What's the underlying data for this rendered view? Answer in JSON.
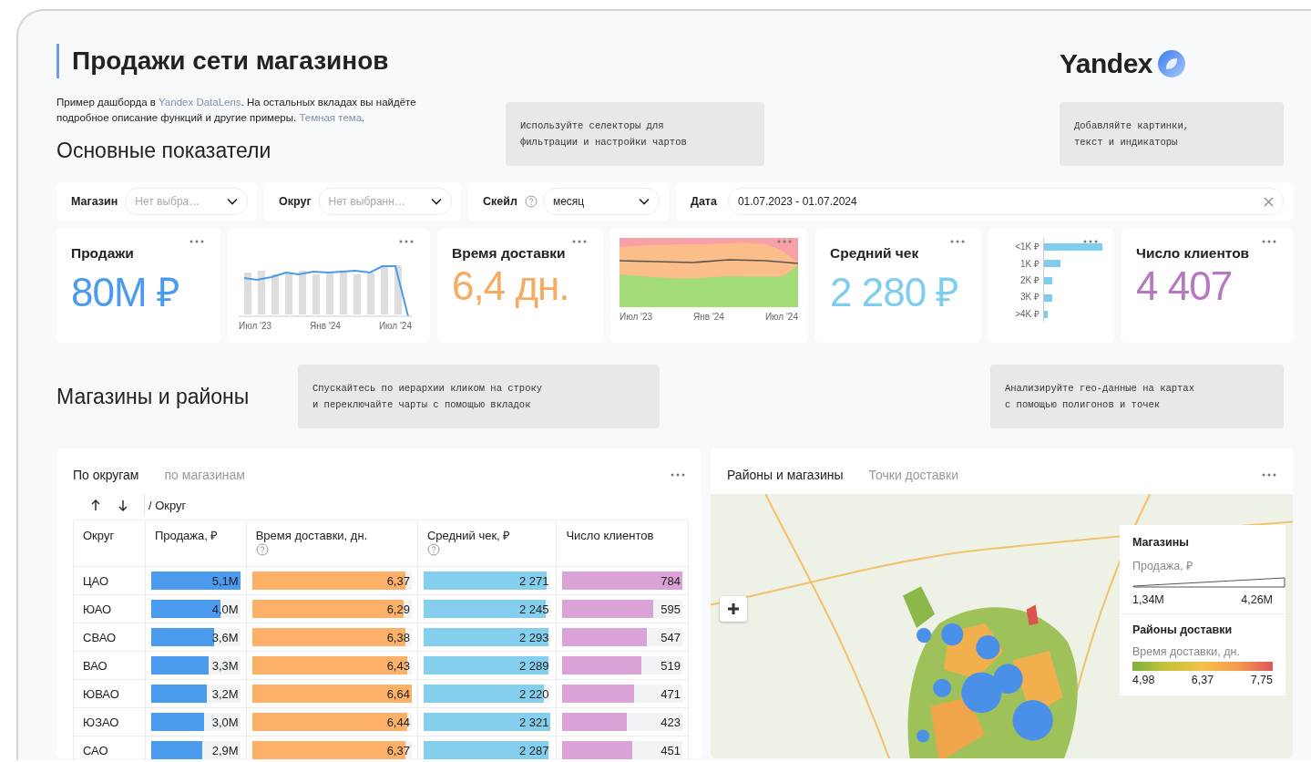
{
  "header": {
    "title": "Продажи сети магазинов",
    "logo": "Yandex",
    "description": [
      {
        "kind": "text",
        "text": "Пример дашборда в "
      },
      {
        "kind": "link",
        "text": "Yandex DataLens"
      },
      {
        "kind": "text",
        "text": ". На остальных вкладах вы найдёте подробное описание функций и другие примеры. "
      },
      {
        "kind": "link",
        "text": "Темная тема"
      },
      {
        "kind": "text",
        "text": "."
      }
    ],
    "hints": [
      "Используйте селекторы для\nфильтрации и настройки чартов",
      "Добавляйте картинки,\nтекст и индикаторы"
    ]
  },
  "metrics_section": {
    "title": "Основные показатели"
  },
  "filters": [
    {
      "kind": "select",
      "label": "Магазин",
      "placeholder": "Нет выбра…",
      "help": false
    },
    {
      "kind": "select",
      "label": "Округ",
      "placeholder": "Нет выбранн…",
      "help": false
    },
    {
      "kind": "select",
      "label": "Скейл",
      "value": "месяц",
      "help": true
    },
    {
      "kind": "date",
      "label": "Дата",
      "value": "01.07.2023 - 01.07.2024",
      "help": false
    }
  ],
  "kpis": [
    {
      "kind": "value",
      "label": "Продажи",
      "value": "80М ₽",
      "color": "#4a9bee"
    },
    {
      "kind": "line",
      "x_labels": [
        "Июл '23",
        "Янв '24",
        "Июл '24"
      ]
    },
    {
      "kind": "value",
      "label": "Время доставки",
      "value": "6,4 дн.",
      "color": "#f7ab60"
    },
    {
      "kind": "band",
      "x_labels": [
        "Июл '23",
        "Янв '24",
        "Июл '24"
      ]
    },
    {
      "kind": "value",
      "label": "Средний чек",
      "value": "2 280 ₽",
      "color": "#7fcdee"
    },
    {
      "kind": "hbar",
      "categories": [
        "<1K ₽",
        "1K ₽",
        "2K ₽",
        "3K ₽",
        ">4K ₽"
      ]
    },
    {
      "kind": "value",
      "label": "Число клиентов",
      "value": "4 407",
      "color": "#b677c0"
    }
  ],
  "stores_section": {
    "title": "Магазины и районы",
    "hints": [
      "Спускайтесь по иерархии кликом на строку\nи переключайте чарты с помощью вкладок",
      "Анализируйте гео-данные на картах\nс помощью полигонов и точек"
    ]
  },
  "table_panel": {
    "tabs": [
      {
        "label": "По округам",
        "selected": true
      },
      {
        "label": "по магазинам",
        "selected": false
      }
    ],
    "breadcrumb": "/ Округ",
    "columns": [
      {
        "label": "Округ",
        "kind": "text",
        "help": false
      },
      {
        "label": "Продажа, ₽",
        "kind": "bar",
        "help": false,
        "color": "#4a9bee"
      },
      {
        "label": "Время доставки, дн.",
        "kind": "bar",
        "help": true,
        "color": "#fdb168"
      },
      {
        "label": "Средний чек, ₽",
        "kind": "bar",
        "help": true,
        "color": "#85cfee"
      },
      {
        "label": "Число клиентов",
        "kind": "bar",
        "help": false,
        "color": "#daa2d6"
      }
    ],
    "rows": [
      {
        "cells": [
          {
            "text": "ЦАО"
          },
          {
            "text": "5,1M",
            "level": 1.0
          },
          {
            "text": "6,37",
            "level": 0.96
          },
          {
            "text": "2 271",
            "level": 0.97
          },
          {
            "text": "784",
            "level": 1.0
          }
        ]
      },
      {
        "cells": [
          {
            "text": "ЮАО"
          },
          {
            "text": "4,0M",
            "level": 0.78
          },
          {
            "text": "6,29",
            "level": 0.95
          },
          {
            "text": "2 245",
            "level": 0.96
          },
          {
            "text": "595",
            "level": 0.76
          }
        ]
      },
      {
        "cells": [
          {
            "text": "СВАО"
          },
          {
            "text": "3,6M",
            "level": 0.71
          },
          {
            "text": "6,38",
            "level": 0.96
          },
          {
            "text": "2 293",
            "level": 0.98
          },
          {
            "text": "547",
            "level": 0.7
          }
        ]
      },
      {
        "cells": [
          {
            "text": "ВАО"
          },
          {
            "text": "3,3M",
            "level": 0.65
          },
          {
            "text": "6,43",
            "level": 0.97
          },
          {
            "text": "2 289",
            "level": 0.98
          },
          {
            "text": "519",
            "level": 0.66
          }
        ]
      },
      {
        "cells": [
          {
            "text": "ЮВАО"
          },
          {
            "text": "3,2M",
            "level": 0.63
          },
          {
            "text": "6,64",
            "level": 1.0
          },
          {
            "text": "2 220",
            "level": 0.95
          },
          {
            "text": "471",
            "level": 0.6
          }
        ]
      },
      {
        "cells": [
          {
            "text": "ЮЗАО"
          },
          {
            "text": "3,0M",
            "level": 0.59
          },
          {
            "text": "6,44",
            "level": 0.97
          },
          {
            "text": "2 321",
            "level": 1.0
          },
          {
            "text": "423",
            "level": 0.54
          }
        ]
      },
      {
        "cells": [
          {
            "text": "САО"
          },
          {
            "text": "2,9M",
            "level": 0.57
          },
          {
            "text": "6,37",
            "level": 0.96
          },
          {
            "text": "2 287",
            "level": 0.98
          },
          {
            "text": "451",
            "level": 0.58
          }
        ]
      }
    ]
  },
  "map_panel": {
    "tabs": [
      {
        "label": "Районы и магазины",
        "selected": true
      },
      {
        "label": "Точки доставки",
        "selected": false
      }
    ],
    "legend": {
      "stores_title": "Магазины",
      "size_label": "Продажа, ₽",
      "size_min": "1,34М",
      "size_max": "4,26М",
      "districts_title": "Районы доставки",
      "color_label": "Время доставки, дн.",
      "color_ticks": [
        "4,98",
        "6,37",
        "7,75"
      ]
    }
  }
}
